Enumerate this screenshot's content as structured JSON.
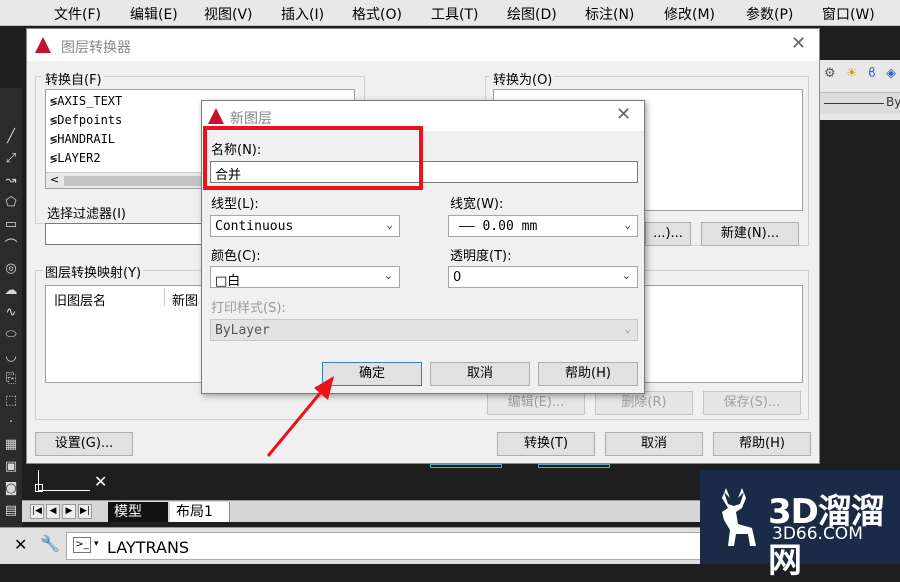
{
  "menu": [
    "文件(F)",
    "编辑(E)",
    "视图(V)",
    "插入(I)",
    "格式(O)",
    "工具(T)",
    "绘图(D)",
    "标注(N)",
    "修改(M)",
    "参数(P)",
    "窗口(W)"
  ],
  "main_dialog": {
    "title": "图层转换器",
    "from_label": "转换自(F)",
    "to_label": "转换为(O)",
    "from_layers": [
      "AXIS_TEXT",
      "Defpoints",
      "HANDRAIL",
      "LAYER2"
    ],
    "filter_label": "选择过滤器(I)",
    "map_label": "图层转换映射(Y)",
    "map_columns": [
      "旧图层名",
      "新图"
    ],
    "load_button": "...)...",
    "new_button": "新建(N)...",
    "edit_button": "编辑(E)...",
    "delete_button": "删除(R)",
    "save_button": "保存(S)...",
    "settings_button": "设置(G)...",
    "convert_button": "转换(T)",
    "cancel_button": "取消",
    "help_button": "帮助(H)"
  },
  "new_layer_dialog": {
    "title": "新图层",
    "name_label": "名称(N):",
    "name_value": "合并",
    "linetype_label": "线型(L):",
    "linetype_value": "Continuous",
    "lineweight_label": "线宽(W):",
    "lineweight_value": "—— 0.00 mm",
    "color_label": "颜色(C):",
    "color_value": "□白",
    "transparency_label": "透明度(T):",
    "transparency_value": "0",
    "plotstyle_label": "打印样式(S):",
    "plotstyle_value": "ByLayer",
    "ok_button": "确定",
    "cancel_button": "取消",
    "help_button": "帮助(H)"
  },
  "layout_tabs": [
    "模型",
    "布局1"
  ],
  "command_line": "LAYTRANS",
  "right_toolbar_text": "By",
  "watermark": {
    "big": "3D溜溜网",
    "small": "3D66.COM"
  },
  "colors": {
    "highlight": "#e8131b",
    "arrow": "#e8131b",
    "autocad_red": "#c8102e",
    "watermark_bg": "#1b2a47"
  }
}
